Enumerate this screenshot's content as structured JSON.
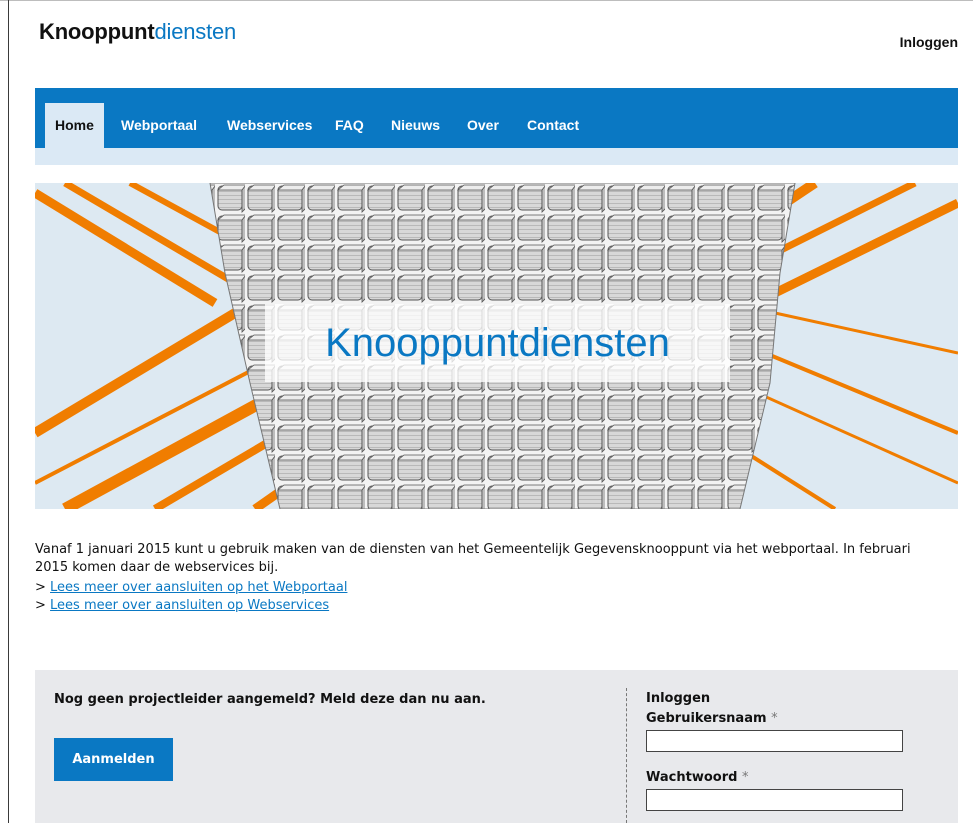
{
  "header": {
    "logo_part1": "Knooppunt",
    "logo_part2": "diensten",
    "login_link": "Inloggen"
  },
  "nav": {
    "items": [
      {
        "label": "Home",
        "active": true
      },
      {
        "label": "Webportaal"
      },
      {
        "label": "Webservices"
      },
      {
        "label": "FAQ"
      },
      {
        "label": "Nieuws"
      },
      {
        "label": "Over"
      },
      {
        "label": "Contact"
      }
    ]
  },
  "hero": {
    "title": "Knooppuntdiensten",
    "image": "network-cubes-illustration"
  },
  "intro": {
    "text": "Vanaf 1 januari 2015 kunt u gebruik maken van de diensten van het Gemeentelijk Gegevensknooppunt via het webportaal. In februari 2015 komen daar de webservices bij.",
    "link_prefix": ">",
    "links": [
      "Lees meer over aansluiten op het Webportaal",
      "Lees meer over aansluiten op Webservices"
    ]
  },
  "panel": {
    "message": "Nog geen projectleider aangemeld? Meld deze dan nu aan.",
    "button": "Aanmelden",
    "login": {
      "title": "Inloggen",
      "username_label": "Gebruikersnaam",
      "password_label": "Wachtwoord",
      "required_mark": "*",
      "username_value": "",
      "password_value": ""
    }
  },
  "colors": {
    "brand_blue": "#0a78c3",
    "nav_sub": "#dbe9f5",
    "accent_orange": "#f07d00",
    "panel_bg": "#e8e9ec"
  }
}
